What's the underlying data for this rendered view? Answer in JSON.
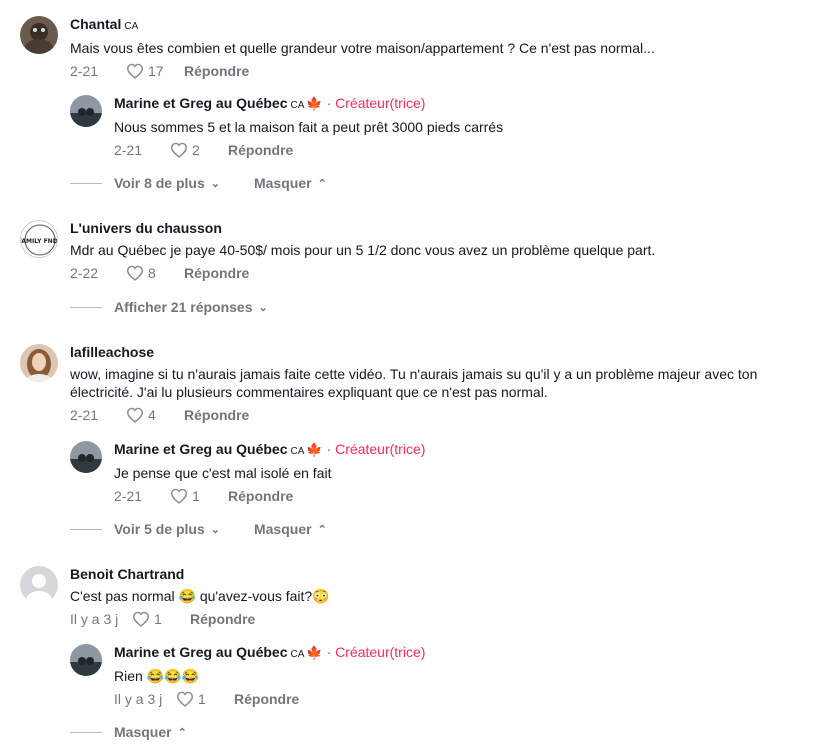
{
  "comments": [
    {
      "name": "Chantal",
      "country": "CA",
      "text": "Mais vous êtes combien et quelle grandeur votre maison/appartement ? Ce n'est pas normal...",
      "date": "2-21",
      "likes": "17",
      "reply_label": "Répondre",
      "reply": {
        "name": "Marine et Greg au Québec",
        "country": "CA",
        "flag": "🍁",
        "creator_label": "· Créateur(trice)",
        "text": "Nous sommes 5 et la maison fait a peut prêt 3000 pieds carrés",
        "date": "2-21",
        "likes": "2",
        "reply_label": "Répondre"
      },
      "more_label": "Voir 8 de plus",
      "hide_label": "Masquer"
    },
    {
      "name": "L'univers du chausson",
      "avatar_text": "FAMILY FNDS",
      "text": "Mdr au Québec je paye 40-50$/ mois pour un 5 1/2 donc vous avez un problème quelque part.",
      "date": "2-22",
      "likes": "8",
      "reply_label": "Répondre",
      "more_label": "Afficher 21 réponses"
    },
    {
      "name": "lafilleachose",
      "text": "wow, imagine si tu n'aurais jamais faite cette vidéo. Tu n'aurais jamais su qu'il y a un problème majeur avec ton électricité. J'ai lu plusieurs commentaires expliquant que ce n'est pas normal.",
      "date": "2-21",
      "likes": "4",
      "reply_label": "Répondre",
      "reply": {
        "name": "Marine et Greg au Québec",
        "country": "CA",
        "flag": "🍁",
        "creator_label": "· Créateur(trice)",
        "text": "Je pense que c'est mal isolé en fait",
        "date": "2-21",
        "likes": "1",
        "reply_label": "Répondre"
      },
      "more_label": "Voir 5 de plus",
      "hide_label": "Masquer"
    },
    {
      "name": "Benoit Chartrand",
      "text": "C'est pas normal 😂  qu'avez-vous fait?😳",
      "date": "Il y a 3 j",
      "likes": "1",
      "reply_label": "Répondre",
      "reply": {
        "name": "Marine et Greg au Québec",
        "country": "CA",
        "flag": "🍁",
        "creator_label": "· Créateur(trice)",
        "text": "Rien 😂😂😂",
        "date": "Il y a 3 j",
        "likes": "1",
        "reply_label": "Répondre"
      },
      "hide_label": "Masquer"
    }
  ]
}
